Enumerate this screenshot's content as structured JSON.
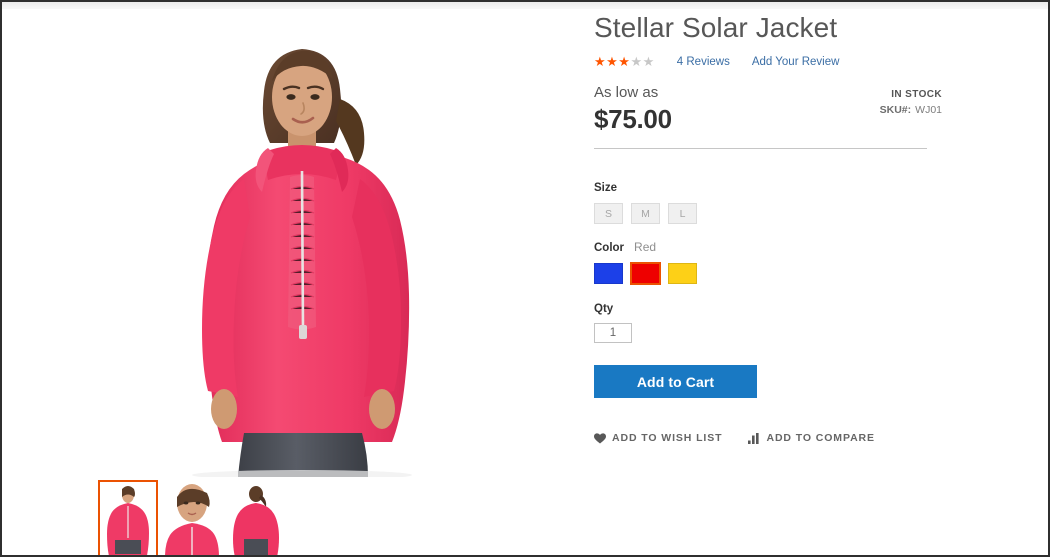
{
  "product": {
    "title": "Stellar Solar Jacket",
    "rating": {
      "filled_stars": 3,
      "total_stars": 5,
      "reviews_link": "4  Reviews",
      "add_review_link": "Add Your Review"
    },
    "price": {
      "prefix": "As low as",
      "amount": "$75.00"
    },
    "availability": {
      "stock_status": "IN STOCK",
      "sku_label": "SKU#:",
      "sku_value": "WJ01"
    },
    "options": {
      "size": {
        "label": "Size",
        "values": [
          "S",
          "M",
          "L"
        ],
        "selected": ""
      },
      "color": {
        "label": "Color",
        "selected_name": "Red",
        "values": [
          {
            "name": "Blue",
            "hex": "#1c40e8",
            "selected": false
          },
          {
            "name": "Red",
            "hex": "#ee0000",
            "selected": true
          },
          {
            "name": "Yellow",
            "hex": "#fdd017",
            "selected": false
          }
        ]
      },
      "qty": {
        "label": "Qty",
        "value": "1"
      }
    },
    "add_to_cart_label": "Add to Cart",
    "wishlist_label": "ADD TO WISH LIST",
    "compare_label": "ADD TO COMPARE"
  },
  "gallery": {
    "main_alt": "Stellar Solar Jacket front view on model",
    "thumbnails": [
      {
        "alt": "front view",
        "selected": true
      },
      {
        "alt": "close-up view",
        "selected": false
      },
      {
        "alt": "back view",
        "selected": false
      }
    ]
  },
  "colors": {
    "accent_blue": "#1979c3",
    "accent_orange": "#eb5202",
    "star_orange": "#ff5501",
    "jacket_pink": "#f03a66"
  }
}
